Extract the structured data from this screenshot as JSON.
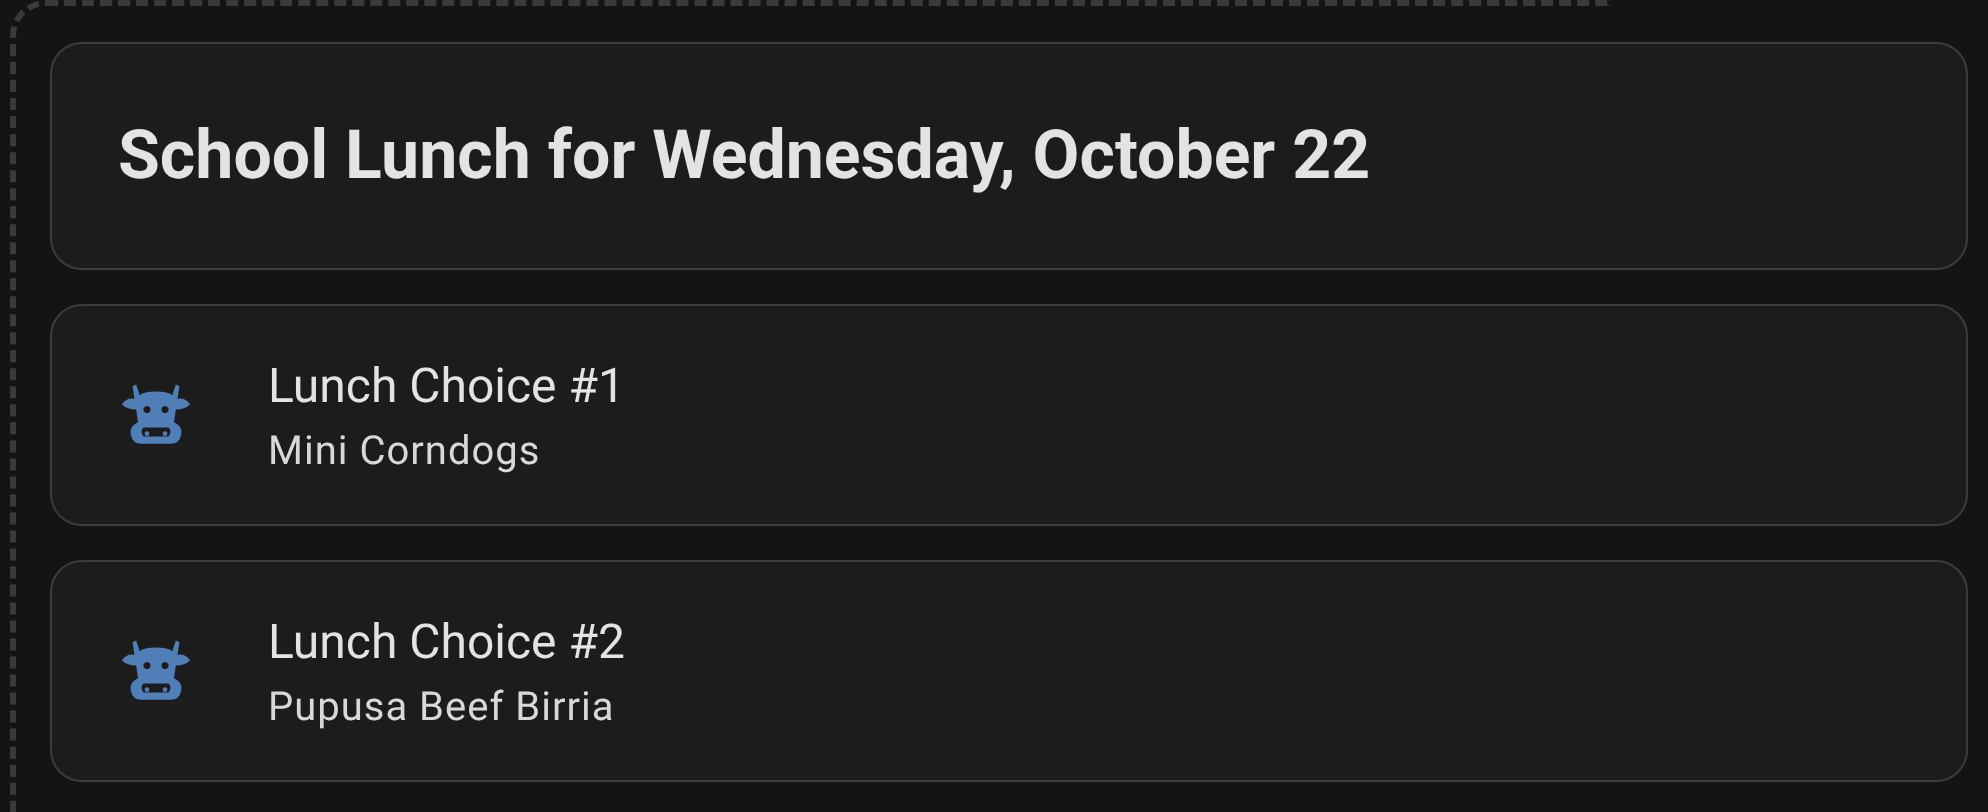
{
  "header": {
    "title": "School Lunch for Wednesday, October 22"
  },
  "choices": [
    {
      "title": "Lunch Choice #1",
      "item": "Mini Corndogs"
    },
    {
      "title": "Lunch Choice #2",
      "item": "Pupusa Beef Birria"
    }
  ]
}
